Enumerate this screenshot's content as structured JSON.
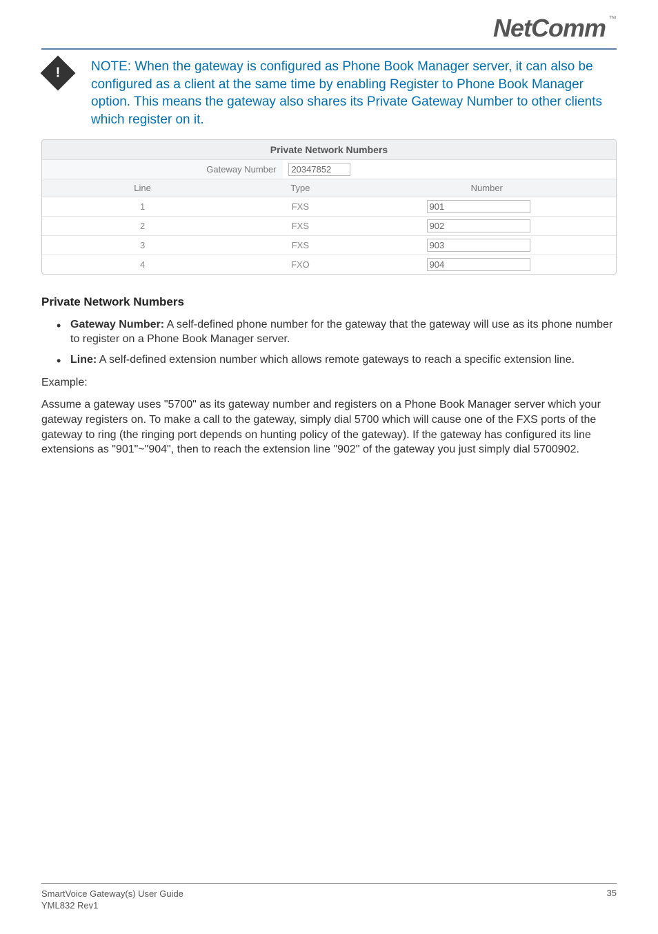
{
  "header": {
    "logo_text": "NetComm",
    "trademark": "™"
  },
  "note": {
    "text": "NOTE: When the gateway is configured as Phone Book Manager server, it can also be configured as a client at the same time by enabling Register to Phone Book Manager option. This means the gateway also shares its Private Gateway Number to other clients which register on it."
  },
  "screenshot": {
    "title": "Private Network Numbers",
    "gateway_label": "Gateway Number",
    "gateway_value": "20347852",
    "columns": {
      "line": "Line",
      "type": "Type",
      "number": "Number"
    },
    "rows": [
      {
        "line": "1",
        "type": "FXS",
        "number": "901"
      },
      {
        "line": "2",
        "type": "FXS",
        "number": "902"
      },
      {
        "line": "3",
        "type": "FXS",
        "number": "903"
      },
      {
        "line": "4",
        "type": "FXO",
        "number": "904"
      }
    ]
  },
  "body": {
    "heading": "Private Network Numbers",
    "bullets": [
      {
        "term": "Gateway Number:",
        "desc": " A self-defined phone number for the gateway that the gateway will use as its phone number to register on a Phone Book Manager server."
      },
      {
        "term": "Line:",
        "desc": " A self-defined extension number which allows remote gateways to reach a specific extension line."
      }
    ],
    "example_label": "Example:",
    "example_text": "Assume a gateway uses \"5700\" as its gateway number and registers on a Phone Book Manager server which your gateway registers on. To make a call to the gateway, simply dial 5700 which will cause one of the FXS ports of the gateway to ring (the ringing port depends on hunting policy of the gateway). If the gateway has configured its line extensions as \"901\"~\"904\", then to reach the extension line \"902\" of the gateway you just simply dial 5700902."
  },
  "footer": {
    "line1": "SmartVoice Gateway(s) User Guide",
    "line2": "YML832 Rev1",
    "page": "35"
  }
}
